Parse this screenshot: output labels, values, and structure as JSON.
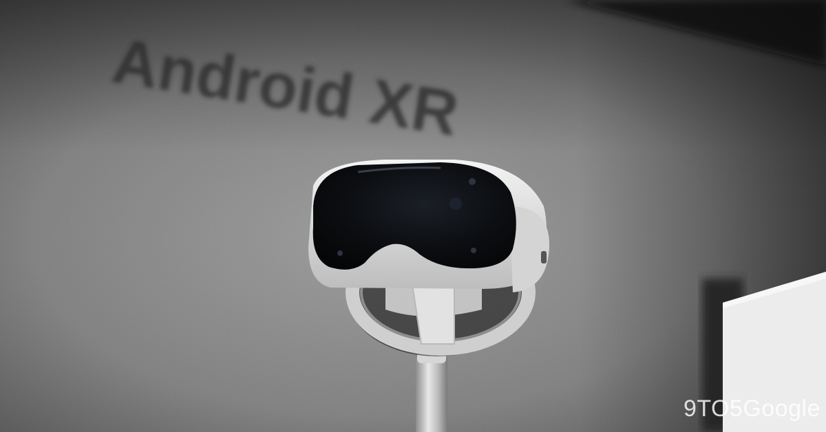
{
  "photo": {
    "wall_sign": "Android XR",
    "subject": "headset-on-display-stand-icon"
  },
  "watermark": {
    "text": "9TO5Google"
  },
  "colors": {
    "wall": "#8d8d8d",
    "wall_dark": "#4a4a4a",
    "sign_text": "#2a2a2a",
    "visor": "#0d0f12",
    "headset_shell": "#e6e6e6",
    "stand_pole": "#c8c8c8"
  }
}
